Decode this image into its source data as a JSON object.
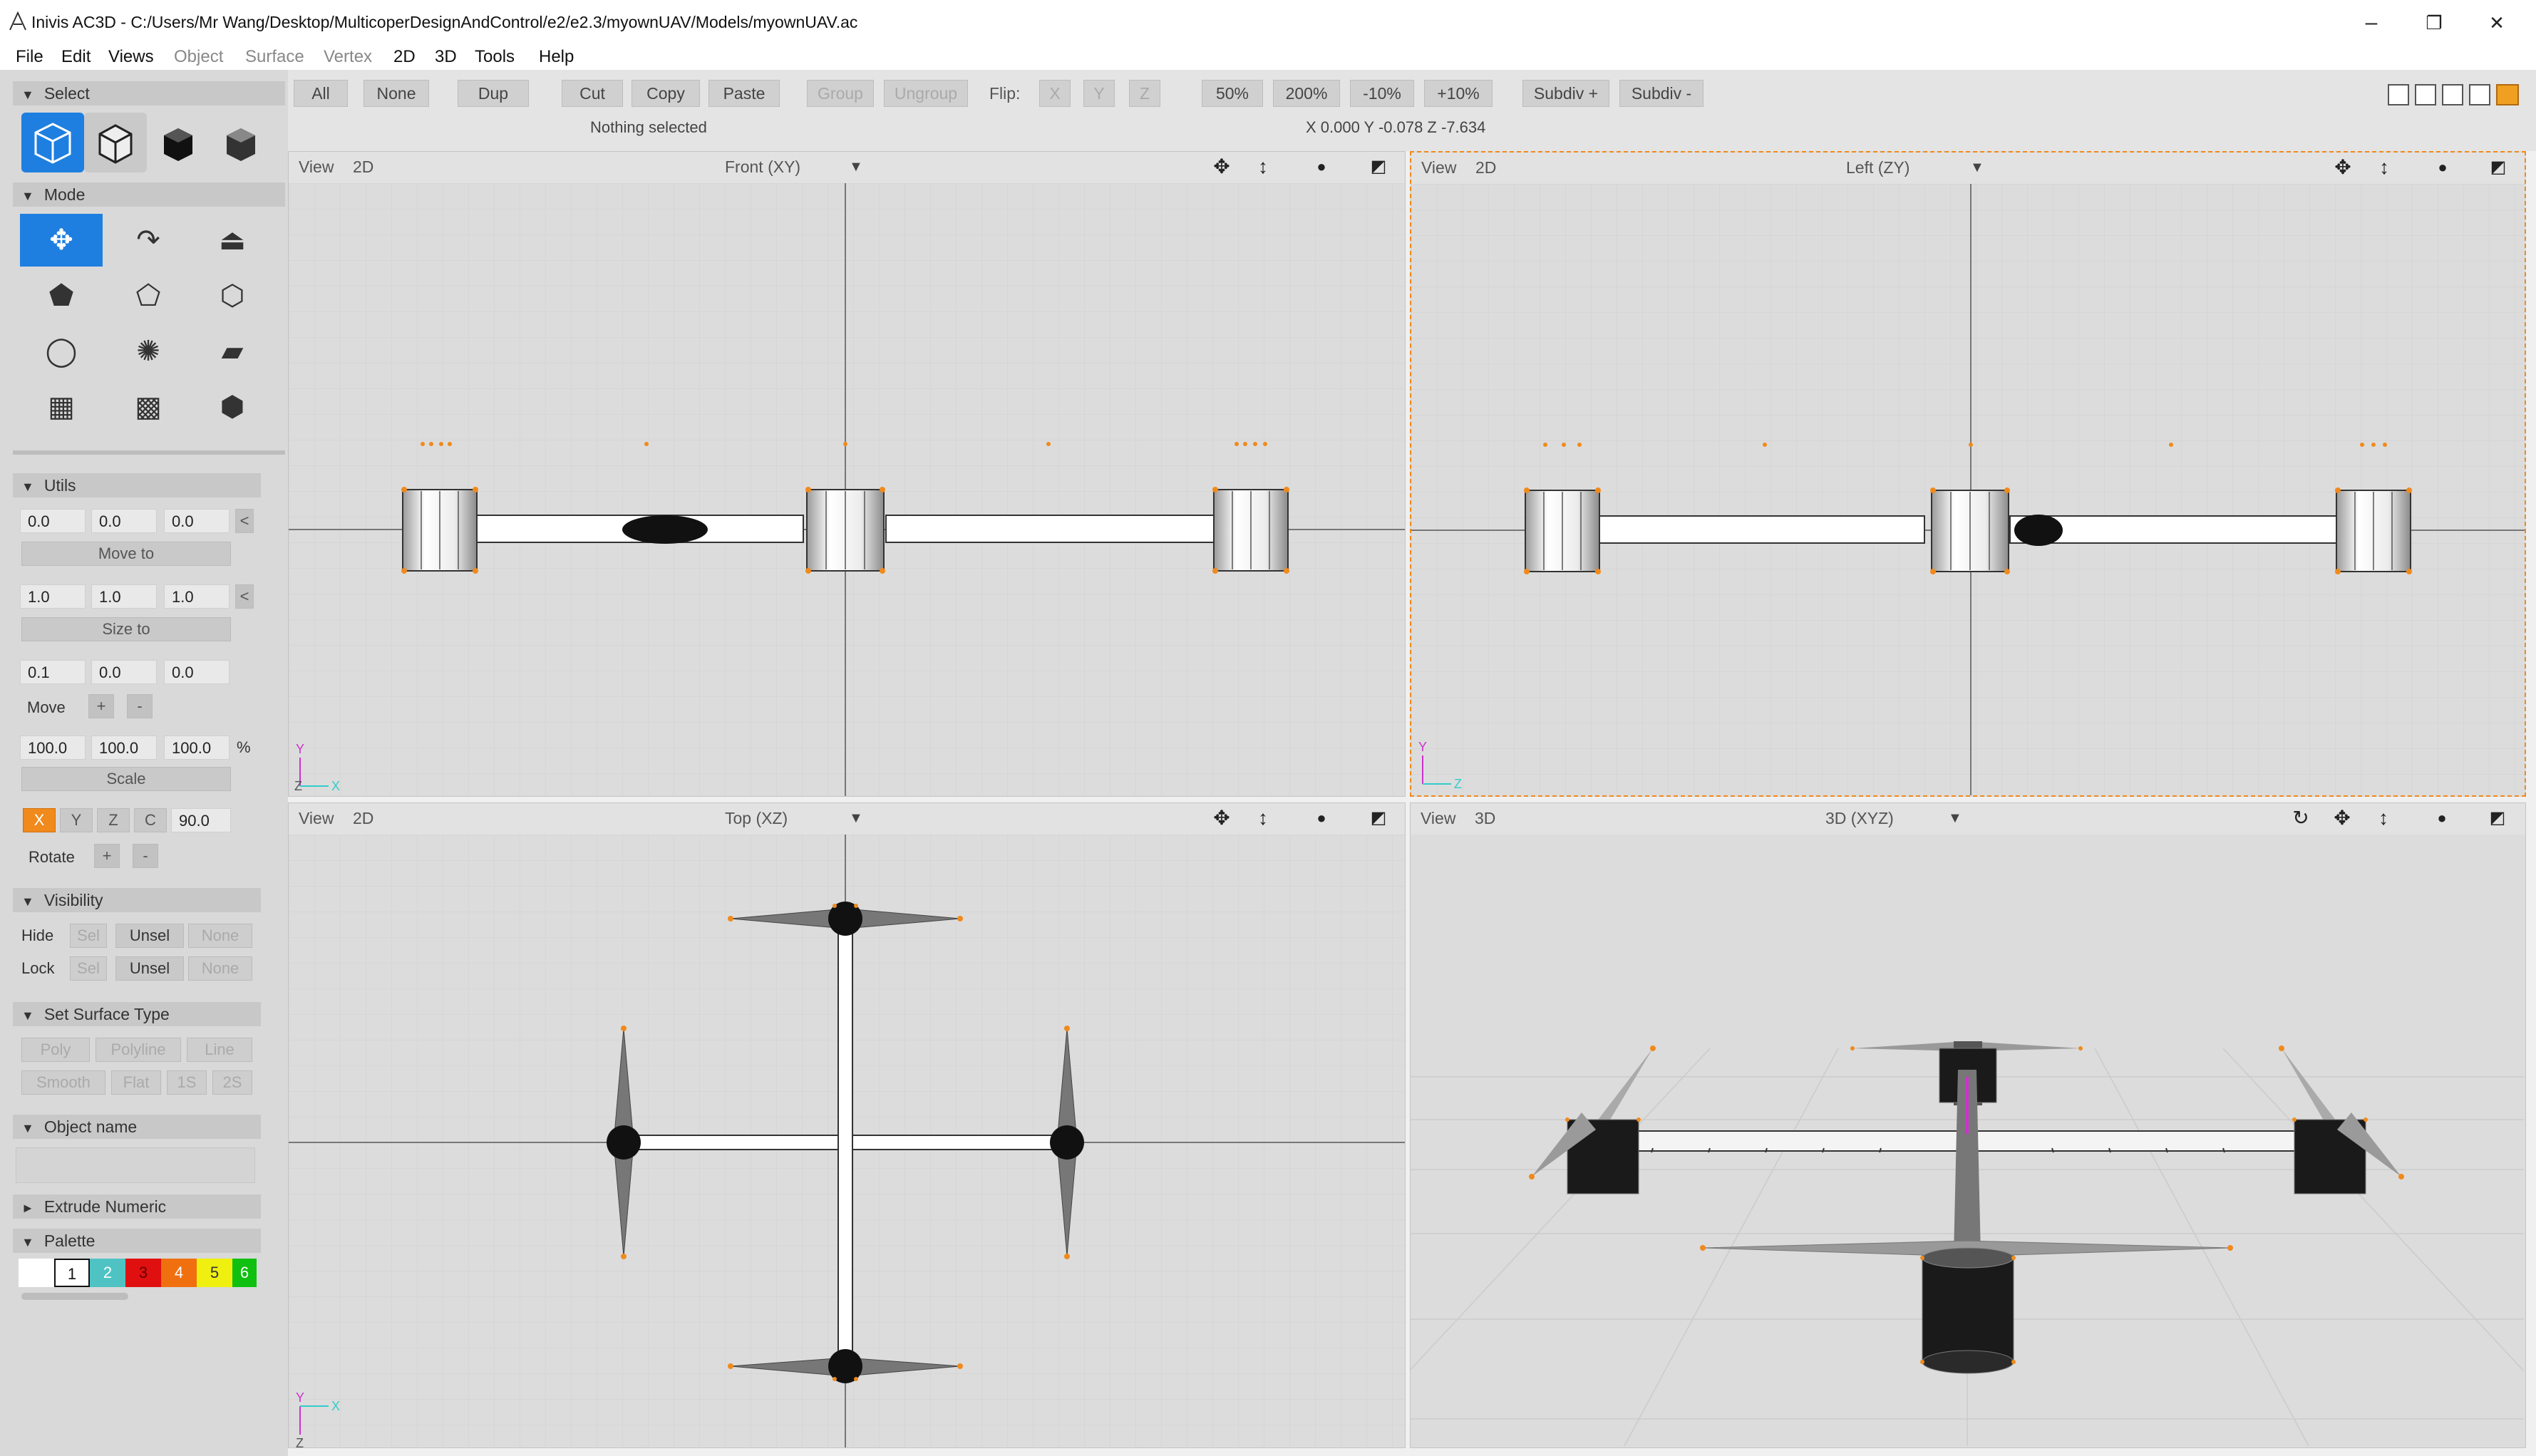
{
  "window": {
    "title": "Inivis AC3D - C:/Users/Mr Wang/Desktop/MulticoperDesignAndControl/e2/e2.3/myownUAV/Models/myownUAV.ac",
    "controls": [
      "–",
      "❐",
      "✕"
    ]
  },
  "menu": [
    {
      "label": "File",
      "enabled": true
    },
    {
      "label": "Edit",
      "enabled": true
    },
    {
      "label": "Views",
      "enabled": true
    },
    {
      "label": "Object",
      "enabled": false
    },
    {
      "label": "Surface",
      "enabled": false
    },
    {
      "label": "Vertex",
      "enabled": false
    },
    {
      "label": "2D",
      "enabled": true
    },
    {
      "label": "3D",
      "enabled": true
    },
    {
      "label": "Tools",
      "enabled": true
    },
    {
      "label": "Help",
      "enabled": true
    }
  ],
  "toolbar": {
    "all": "All",
    "none": "None",
    "dup": "Dup",
    "cut": "Cut",
    "copy": "Copy",
    "paste": "Paste",
    "group": "Group",
    "ungroup": "Ungroup",
    "flip_label": "Flip:",
    "flip_x": "X",
    "flip_y": "Y",
    "flip_z": "Z",
    "zoom50": "50%",
    "zoom200": "200%",
    "minus10": "-10%",
    "plus10": "+10%",
    "subdiv_plus": "Subdiv +",
    "subdiv_minus": "Subdiv -"
  },
  "status": {
    "selection": "Nothing selected",
    "coords": "X 0.000 Y -0.078 Z -7.634"
  },
  "left": {
    "select_title": "Select",
    "mode_title": "Mode",
    "utils": {
      "title": "Utils",
      "pos": [
        "0.0",
        "0.0",
        "0.0"
      ],
      "move_to": "Move to",
      "size": [
        "1.0",
        "1.0",
        "1.0"
      ],
      "size_to": "Size to",
      "move_vals": [
        "0.1",
        "0.0",
        "0.0"
      ],
      "move": "Move",
      "plus": "+",
      "minus": "-",
      "scale_vals": [
        "100.0",
        "100.0",
        "100.0"
      ],
      "percent": "%",
      "scale": "Scale",
      "axes": [
        "X",
        "Y",
        "Z",
        "C"
      ],
      "angle": "90.0",
      "rotate": "Rotate",
      "lt": "<"
    },
    "visibility": {
      "title": "Visibility",
      "hide": "Hide",
      "lock": "Lock",
      "sel": "Sel",
      "unsel": "Unsel",
      "none": "None"
    },
    "surface": {
      "title": "Set Surface Type",
      "poly": "Poly",
      "polyline": "Polyline",
      "line": "Line",
      "smooth": "Smooth",
      "flat": "Flat",
      "s1": "1S",
      "s2": "2S"
    },
    "object_name": {
      "title": "Object name"
    },
    "extrude": {
      "title": "Extrude Numeric"
    },
    "palette": {
      "title": "Palette",
      "swatches": [
        {
          "label": "",
          "color": "#ffffff"
        },
        {
          "label": "1",
          "color": "#ffffff"
        },
        {
          "label": "2",
          "color": "#4fc3c3"
        },
        {
          "label": "3",
          "color": "#e01010"
        },
        {
          "label": "4",
          "color": "#f07010"
        },
        {
          "label": "5",
          "color": "#f0f010"
        },
        {
          "label": "6",
          "color": "#10c010"
        }
      ]
    }
  },
  "viewports": {
    "front": {
      "view": "View",
      "dim": "2D",
      "projection": "Front (XY)",
      "axis_v": "Y",
      "axis_h": "X",
      "corner": "Z"
    },
    "left": {
      "view": "View",
      "dim": "2D",
      "projection": "Left (ZY)",
      "axis_v": "Y",
      "axis_h": "Z"
    },
    "top": {
      "view": "View",
      "dim": "2D",
      "projection": "Top (XZ)",
      "axis_v": "Y",
      "axis_h": "X",
      "corner": "Z"
    },
    "persp": {
      "view": "View",
      "dim": "3D",
      "projection": "3D (XYZ)"
    }
  },
  "colors": {
    "accent": "#1e7fe0",
    "selection_outline": "#f08a1c",
    "axis_x": "#33cccc",
    "axis_y": "#cc33cc"
  }
}
